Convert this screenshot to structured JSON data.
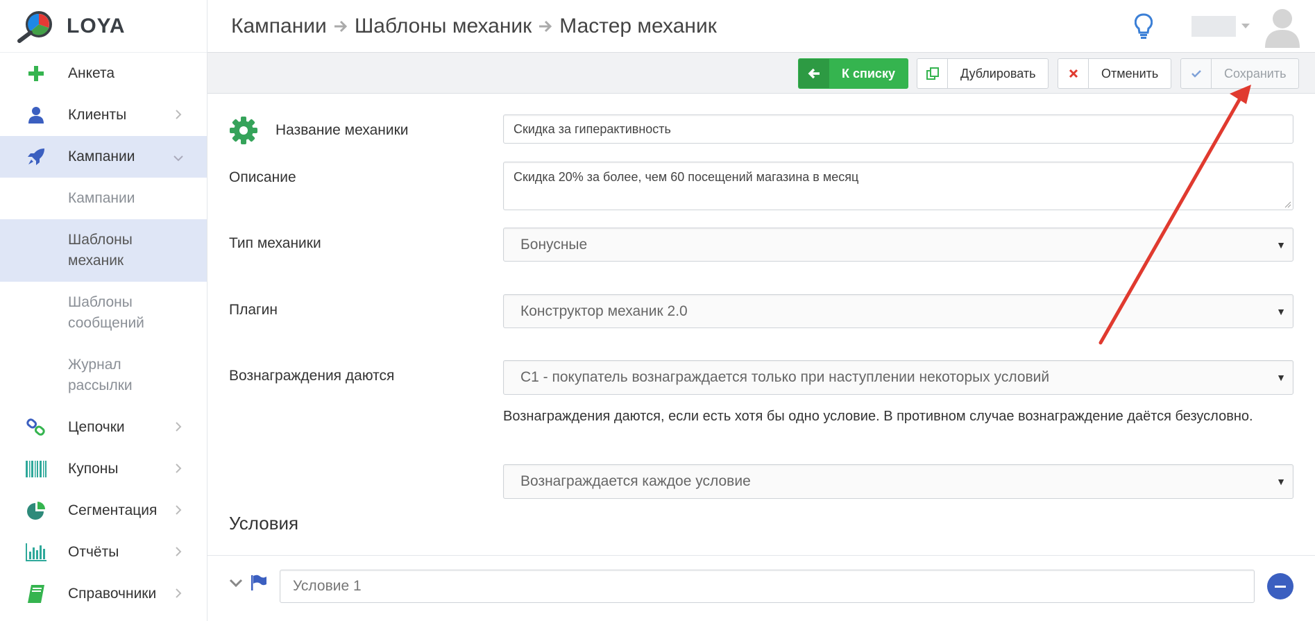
{
  "app": {
    "name": "LOYA"
  },
  "sidebar": {
    "items": [
      {
        "label": "Анкета",
        "icon": "plus-icon"
      },
      {
        "label": "Клиенты",
        "icon": "user-icon"
      },
      {
        "label": "Кампании",
        "icon": "rocket-icon"
      },
      {
        "label": "Цепочки",
        "icon": "link-icon"
      },
      {
        "label": "Купоны",
        "icon": "barcode-icon"
      },
      {
        "label": "Сегментация",
        "icon": "pie-chart-icon"
      },
      {
        "label": "Отчёты",
        "icon": "bar-chart-icon"
      },
      {
        "label": "Справочники",
        "icon": "book-icon"
      }
    ],
    "sub_items": [
      {
        "label": "Кампании"
      },
      {
        "label": "Шаблоны механик"
      },
      {
        "label": "Шаблоны сообщений"
      },
      {
        "label": "Журнал рассылки"
      }
    ]
  },
  "breadcrumb": [
    "Кампании",
    "Шаблоны механик",
    "Мастер механик"
  ],
  "toolbar": {
    "back_label": "К списку",
    "duplicate_label": "Дублировать",
    "cancel_label": "Отменить",
    "save_label": "Сохранить"
  },
  "form": {
    "name_label": "Название механики",
    "name_value": "Скидка за гиперактивность",
    "description_label": "Описание",
    "description_value": "Скидка 20% за более, чем 60 посещений магазина в месяц",
    "type_label": "Тип механики",
    "type_value": "Бонусные",
    "plugin_label": "Плагин",
    "plugin_value": "Конструктор механик 2.0",
    "rewards_label": "Вознаграждения даются",
    "rewards_value": "С1 - покупатель вознаграждается только при наступлении некоторых условий",
    "rewards_hint": "Вознаграждения даются, если есть хотя бы одно условие. В противном случае вознаграждение даётся безусловно.",
    "reward_mode_value": "Вознаграждается каждое условие"
  },
  "conditions": {
    "title": "Условия",
    "items": [
      {
        "placeholder": "Условие 1"
      }
    ]
  },
  "colors": {
    "accent_green": "#35b44f",
    "active_bg": "#dfe6f6",
    "arrow_red": "#e03a2f"
  }
}
